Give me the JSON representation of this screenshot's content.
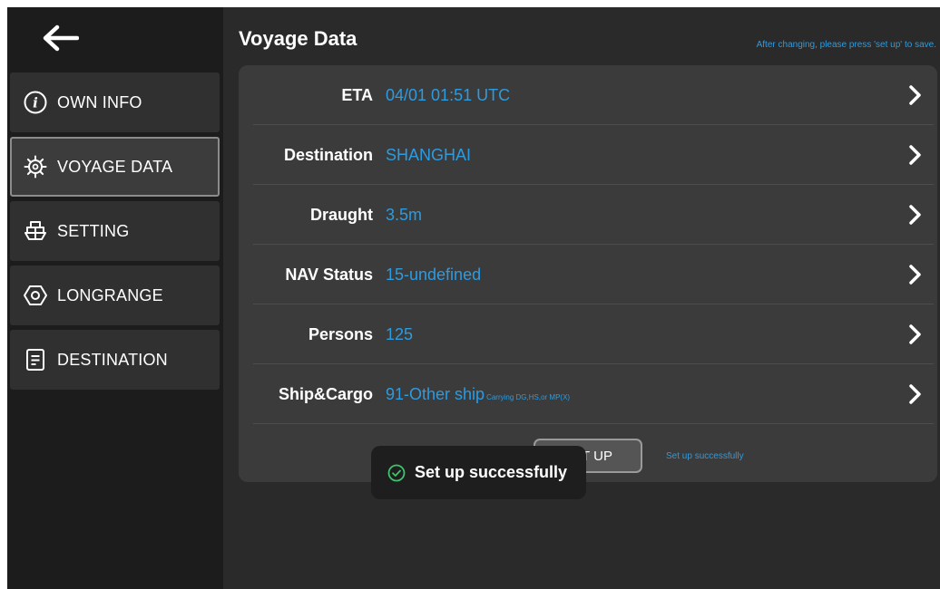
{
  "sidebar": {
    "back_icon": "arrow-left-icon",
    "items": [
      {
        "label": "OWN INFO",
        "icon": "info-circle-icon",
        "active": false
      },
      {
        "label": "VOYAGE DATA",
        "icon": "ship-wheel-icon",
        "active": true
      },
      {
        "label": "SETTING",
        "icon": "ship-icon",
        "active": false
      },
      {
        "label": "LONGRANGE",
        "icon": "hexagon-icon",
        "active": false
      },
      {
        "label": "DESTINATION",
        "icon": "document-icon",
        "active": false
      }
    ]
  },
  "main": {
    "title": "Voyage Data",
    "hint": "After changing, please press 'set up' to save.",
    "rows": [
      {
        "label": "ETA",
        "value": "04/01 01:51 UTC",
        "sub": ""
      },
      {
        "label": "Destination",
        "value": "SHANGHAI",
        "sub": ""
      },
      {
        "label": "Draught",
        "value": "3.5m",
        "sub": ""
      },
      {
        "label": "NAV Status",
        "value": "15-undefined",
        "sub": ""
      },
      {
        "label": "Persons",
        "value": "125",
        "sub": ""
      },
      {
        "label": "Ship&Cargo",
        "value": "91-Other ship",
        "sub": "Carrying DG,HS,or MP(X)"
      }
    ],
    "setup_button": "SET UP",
    "setup_status": "Set up successfully"
  },
  "toast": {
    "text": "Set up successfully",
    "icon": "check-circle-icon"
  },
  "colors": {
    "accent": "#2d9be0",
    "toast_check": "#3ec46d",
    "background": "#2a2a2a",
    "sidebar": "#1c1c1c",
    "card": "#3b3b3b"
  }
}
